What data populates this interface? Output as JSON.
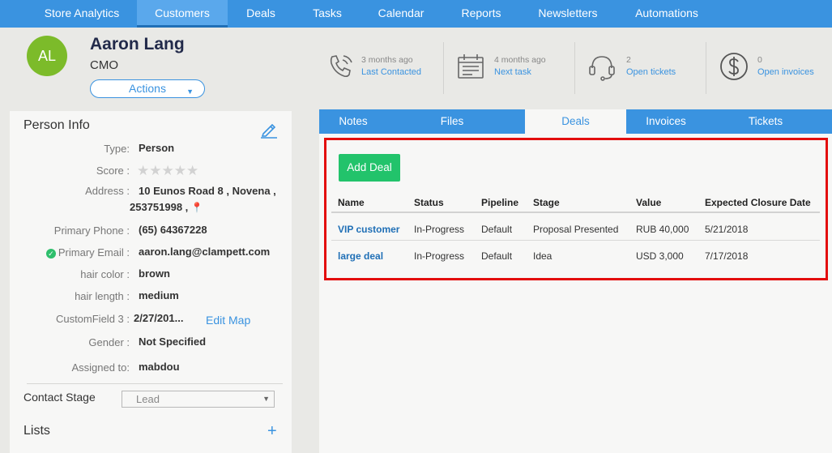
{
  "nav": {
    "items": [
      "Store Analytics",
      "Customers",
      "Deals",
      "Tasks",
      "Calendar",
      "Reports",
      "Newsletters",
      "Automations"
    ],
    "active": "Customers"
  },
  "person": {
    "initials": "AL",
    "name": "Aaron Lang",
    "title": "CMO",
    "actions_label": "Actions"
  },
  "stats": [
    {
      "icon": "phone-icon",
      "value": "3 months ago",
      "label": "Last Contacted"
    },
    {
      "icon": "calendar-icon",
      "value": "4 months ago",
      "label": "Next task"
    },
    {
      "icon": "headset-icon",
      "value": "2",
      "label": "Open tickets"
    },
    {
      "icon": "dollar-icon",
      "value": "0",
      "label": "Open invoices"
    }
  ],
  "person_info": {
    "title": "Person Info",
    "fields": {
      "type": {
        "label": "Type:",
        "value": "Person"
      },
      "score": {
        "label": "Score :",
        "stars": 0,
        "max_stars": 5
      },
      "address": {
        "label": "Address :",
        "line1": "10 Eunos Road 8 , Novena ,",
        "line2": "253751998 ,"
      },
      "primary_phone": {
        "label": "Primary Phone :",
        "value": "(65) 64367228"
      },
      "primary_email": {
        "label": "Primary Email :",
        "value": "aaron.lang@clampett.com"
      },
      "hair_color": {
        "label": "hair color :",
        "value": "brown"
      },
      "hair_length": {
        "label": "hair length :",
        "value": "medium"
      },
      "custom_field_3": {
        "label": "CustomField 3 :",
        "value": "2/27/201..."
      },
      "gender": {
        "label": "Gender :",
        "value": "Not Specified"
      },
      "assigned_to": {
        "label": "Assigned to:",
        "value": "mabdou"
      }
    },
    "edit_map_label": "Edit Map",
    "contact_stage_label": "Contact Stage",
    "contact_stage_value": "Lead",
    "lists_label": "Lists",
    "lists_add": "+"
  },
  "tabs": {
    "items": [
      "Notes",
      "Files",
      "Deals",
      "Invoices",
      "Tickets"
    ],
    "active": "Deals"
  },
  "deals": {
    "add_label": "Add Deal",
    "columns": [
      "Name",
      "Status",
      "Pipeline",
      "Stage",
      "Value",
      "Expected Closure Date"
    ],
    "rows": [
      [
        "VIP customer",
        "In-Progress",
        "Default",
        "Proposal Presented",
        "RUB 40,000",
        "5/21/2018"
      ],
      [
        "large deal",
        "In-Progress",
        "Default",
        "Idea",
        "USD 3,000",
        "7/17/2018"
      ]
    ]
  },
  "colors": {
    "nav_blue": "#3a93e0",
    "avatar_green": "#7cbb2a",
    "add_button_green": "#22c36b",
    "highlight_red": "#e30d0d"
  }
}
